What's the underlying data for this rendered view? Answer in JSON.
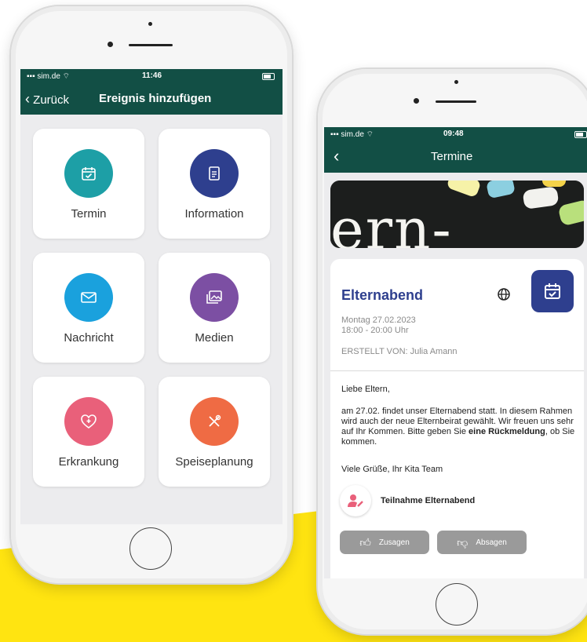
{
  "colors": {
    "header": "#124f45",
    "yellow": "#ffe411",
    "termin": "#1d9fa6",
    "information": "#2e3f8e",
    "nachricht": "#1aa1dd",
    "medien": "#7c4fa3",
    "erkrankung": "#e9607a",
    "speiseplanung": "#ef6b44",
    "event_accent": "#2e3f8e",
    "button_grey": "#9a9a9a"
  },
  "phone_left": {
    "status": {
      "carrier": "sim.de",
      "time": "11:46"
    },
    "nav": {
      "back_label": "Zurück",
      "title": "Ereignis hinzufügen"
    },
    "tiles": [
      {
        "label": "Termin",
        "icon": "calendar-check-icon"
      },
      {
        "label": "Information",
        "icon": "document-icon"
      },
      {
        "label": "Nachricht",
        "icon": "envelope-icon"
      },
      {
        "label": "Medien",
        "icon": "image-gallery-icon"
      },
      {
        "label": "Erkrankung",
        "icon": "heart-plus-icon"
      },
      {
        "label": "Speiseplanung",
        "icon": "cutlery-icon"
      }
    ]
  },
  "phone_right": {
    "status": {
      "carrier": "sim.de",
      "time": "09:48"
    },
    "nav": {
      "title": "Termine"
    },
    "event": {
      "title": "Elternabend",
      "date": "Montag 27.02.2023",
      "time": "18:00 - 20:00 Uhr",
      "created_by": "ERSTELLT VON: Julia Amann",
      "greeting": "Liebe Eltern,",
      "body_before": "am 27.02. findet unser Elternabend statt. In diesem Rahmen wird auch der neue Elternbeirat gewählt. Wir freuen uns sehr auf Ihr Kommen. Bitte geben Sie ",
      "body_bold": "eine Rückmeldung",
      "body_after": ", ob Sie kommen.",
      "closing": "Viele Grüße, Ihr Kita Team",
      "rsvp_title": "Teilnahme Elternabend",
      "accept_label": "Zusagen",
      "decline_label": "Absagen",
      "banner_text": "ern-"
    }
  }
}
